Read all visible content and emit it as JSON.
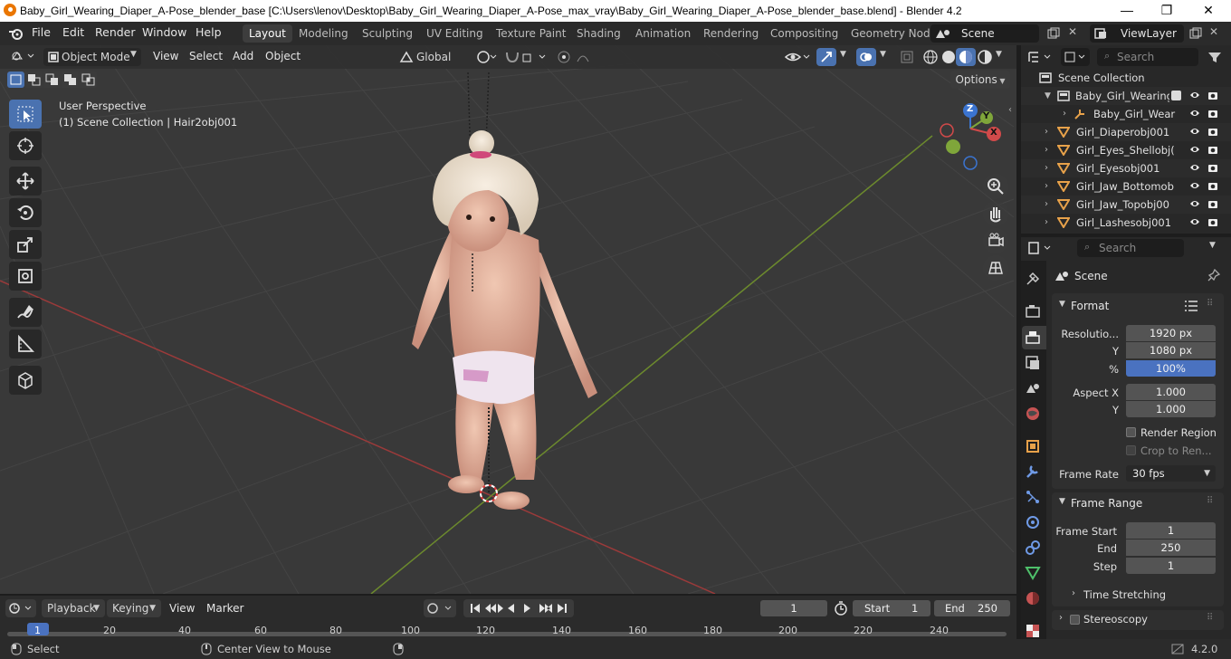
{
  "window": {
    "title": "Baby_Girl_Wearing_Diaper_A-Pose_blender_base [C:\\Users\\lenov\\Desktop\\Baby_Girl_Wearing_Diaper_A-Pose_max_vray\\Baby_Girl_Wearing_Diaper_A-Pose_blender_base.blend] - Blender 4.2",
    "minimize": "—",
    "maximize": "❐",
    "close": "✕"
  },
  "menus": [
    "File",
    "Edit",
    "Render",
    "Window",
    "Help"
  ],
  "workspaces": [
    "Layout",
    "Modeling",
    "Sculpting",
    "UV Editing",
    "Texture Paint",
    "Shading",
    "Animation",
    "Rendering",
    "Compositing",
    "Geometry Nod"
  ],
  "active_workspace": "Layout",
  "scene_field": "Scene",
  "view_layer_field": "ViewLayer",
  "viewport_header": {
    "mode": "Object Mode",
    "menus": [
      "View",
      "Select",
      "Add",
      "Object"
    ],
    "transform": "Global",
    "options": "Options"
  },
  "viewport_overlay": {
    "line1": "User Perspective",
    "line2": "(1) Scene Collection | Hair2obj001"
  },
  "gizmo": {
    "x": "X",
    "y": "Y",
    "z": "Z"
  },
  "outliner": {
    "search_placeholder": "Search",
    "root": "Scene Collection",
    "items": [
      "Baby_Girl_Wearing_",
      "Baby_Girl_Wear",
      "Girl_Diaperobj001",
      "Girl_Eyes_Shellobj(",
      "Girl_Eyesobj001",
      "Girl_Jaw_Bottomob",
      "Girl_Jaw_Topobj00",
      "Girl_Lashesobj001"
    ]
  },
  "properties": {
    "search_placeholder": "Search",
    "context": "Scene",
    "format": {
      "title": "Format",
      "resolution_label": "Resolutio...",
      "res_x": "1920 px",
      "y_label": "Y",
      "res_y": "1080 px",
      "pct_label": "%",
      "pct": "100%",
      "aspect_x_label": "Aspect X",
      "aspect_x": "1.000",
      "aspect_y_label": "Y",
      "aspect_y": "1.000",
      "render_region": "Render Region",
      "crop": "Crop to Ren...",
      "frame_rate_label": "Frame Rate",
      "frame_rate": "30 fps"
    },
    "frame_range": {
      "title": "Frame Range",
      "start_label": "Frame Start",
      "start": "1",
      "end_label": "End",
      "end": "250",
      "step_label": "Step",
      "step": "1"
    },
    "time_stretching": "Time Stretching",
    "stereoscopy": "Stereoscopy"
  },
  "timeline": {
    "menus": [
      "Playback",
      "Keying",
      "View",
      "Marker"
    ],
    "current_frame": "1",
    "start_label": "Start",
    "start": "1",
    "end_label": "End",
    "end": "250",
    "ticks": [
      "1",
      "20",
      "40",
      "60",
      "80",
      "100",
      "120",
      "140",
      "160",
      "180",
      "200",
      "220",
      "240"
    ]
  },
  "statusbar": {
    "select": "Select",
    "center": "Center View to Mouse",
    "version": "4.2.0"
  }
}
